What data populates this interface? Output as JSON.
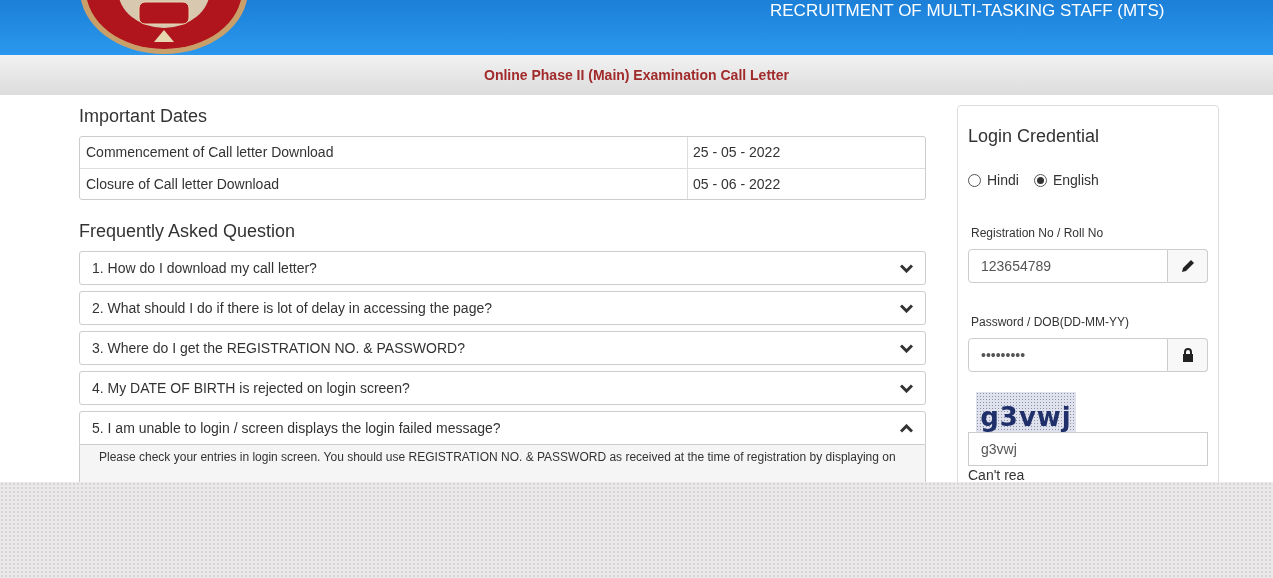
{
  "header": {
    "title": "RECRUITMENT OF MULTI-TASKING STAFF (MTS)"
  },
  "title_bar": {
    "title": "Online Phase II (Main) Examination Call Letter"
  },
  "important_dates": {
    "heading": "Important Dates",
    "rows": [
      {
        "label": "Commencement of Call letter Download",
        "date": "25 - 05 - 2022"
      },
      {
        "label": "Closure of Call letter Download",
        "date": "05 - 06 - 2022"
      }
    ]
  },
  "faq": {
    "heading": "Frequently Asked Question",
    "items": [
      {
        "question": "1. How do I download my call letter?",
        "expanded": false
      },
      {
        "question": "2. What should I do if there is lot of delay in accessing the page?",
        "expanded": false
      },
      {
        "question": "3. Where do I get the REGISTRATION NO. & PASSWORD?",
        "expanded": false
      },
      {
        "question": "4. My DATE OF BIRTH is rejected on login screen?",
        "expanded": false
      },
      {
        "question": "5. I am unable to login / screen displays the login failed message?",
        "expanded": true,
        "answer": "Please check your entries in login screen. You should use REGISTRATION NO. & PASSWORD as received at the time of registration by displaying on"
      }
    ]
  },
  "login": {
    "heading": "Login Credential",
    "languages": [
      {
        "label": "Hindi",
        "selected": false
      },
      {
        "label": "English",
        "selected": true
      }
    ],
    "registration": {
      "label": "Registration No / Roll No",
      "value": "123654789"
    },
    "password": {
      "label": "Password / DOB(DD-MM-YY)",
      "value": "•••••••••"
    },
    "captcha_text": "g3vwj",
    "captcha_input": {
      "value": "g3vwj"
    },
    "cant_read": "Can't rea"
  }
}
